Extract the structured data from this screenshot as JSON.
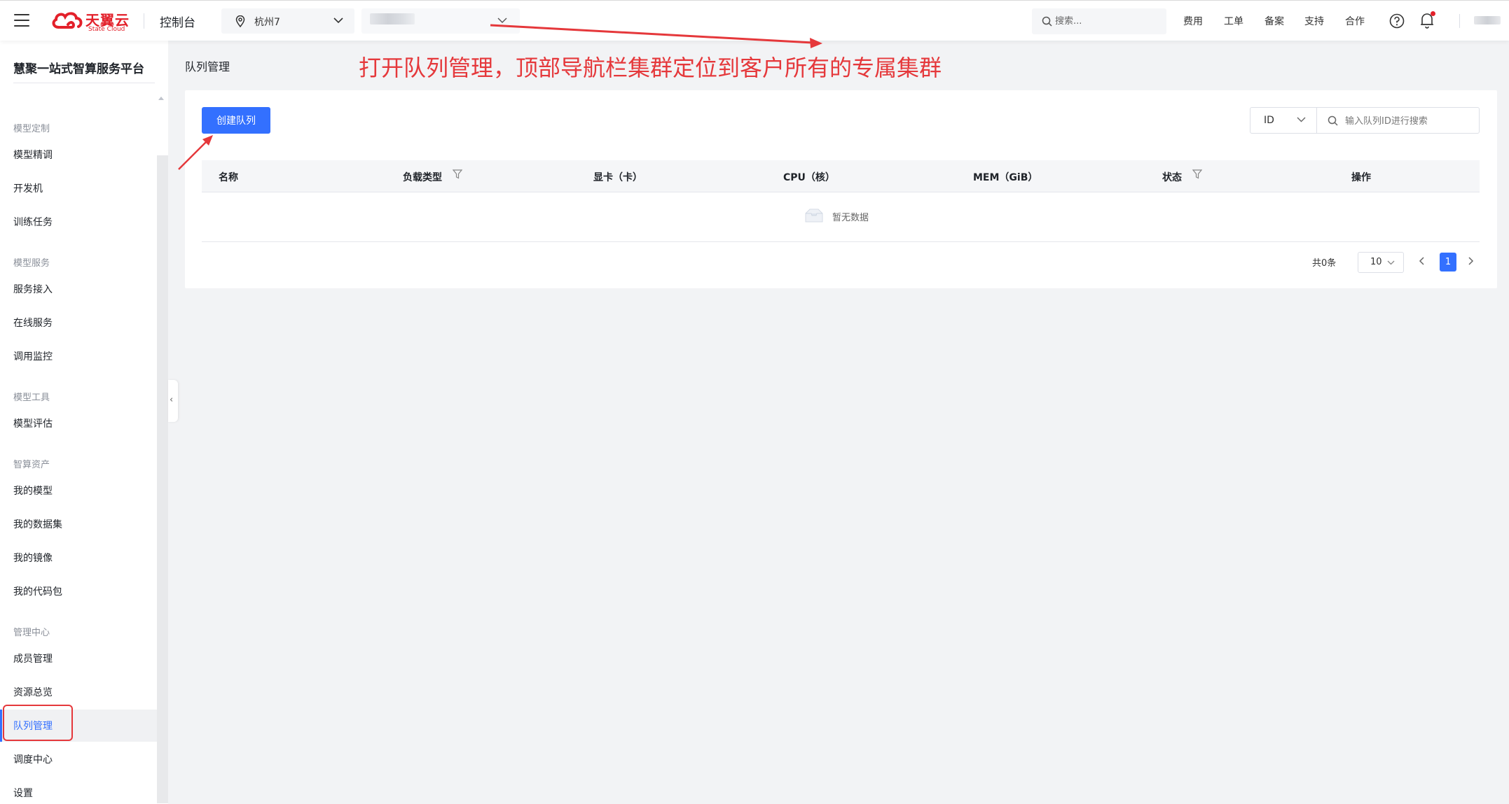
{
  "header": {
    "logo_text": "天翼云",
    "logo_sub": "State Cloud",
    "console_title": "控制台",
    "region": "杭州7",
    "search_placeholder": "搜索...",
    "nav": [
      "费用",
      "工单",
      "备案",
      "支持",
      "合作"
    ]
  },
  "sidebar": {
    "title": "慧聚一站式智算服务平台",
    "groups": [
      {
        "label": "模型定制",
        "items": [
          "模型精调",
          "开发机",
          "训练任务"
        ]
      },
      {
        "label": "模型服务",
        "items": [
          "服务接入",
          "在线服务",
          "调用监控"
        ]
      },
      {
        "label": "模型工具",
        "items": [
          "模型评估"
        ]
      },
      {
        "label": "智算资产",
        "items": [
          "我的模型",
          "我的数据集",
          "我的镜像",
          "我的代码包"
        ]
      },
      {
        "label": "管理中心",
        "items": [
          "成员管理",
          "资源总览",
          "队列管理",
          "调度中心",
          "设置"
        ]
      }
    ],
    "active_item": "队列管理"
  },
  "main": {
    "breadcrumb": "队列管理",
    "annotation": "打开队列管理，顶部导航栏集群定位到客户所有的专属集群",
    "create_button": "创建队列",
    "filter_select": "ID",
    "search_placeholder": "输入队列ID进行搜索",
    "columns": [
      "名称",
      "负载类型",
      "显卡（卡）",
      "CPU（核）",
      "MEM（GiB）",
      "状态",
      "操作"
    ],
    "empty_text": "暂无数据",
    "pagination": {
      "total": "共0条",
      "page_size": "10",
      "current_page": "1"
    }
  },
  "colors": {
    "accent": "#3370ff",
    "brand_red": "#e3202a",
    "annotation_red": "#e5383b"
  }
}
